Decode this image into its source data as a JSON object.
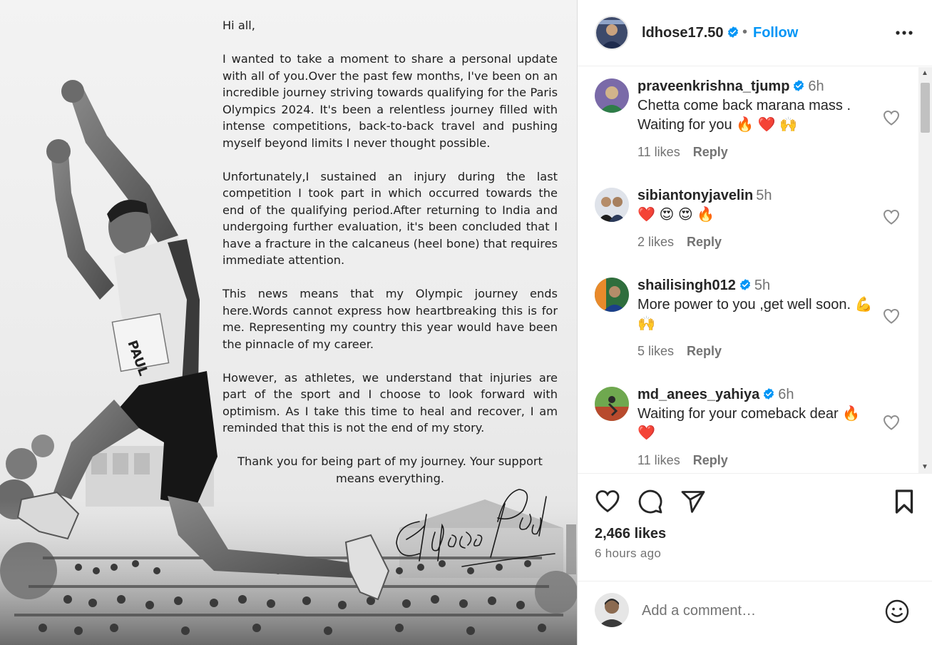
{
  "letter": {
    "greeting": "Hi all,",
    "p1": "I wanted to take a moment to share a  personal update with all of you.Over the past few months, I've been on an incredible journey striving towards qualifying for the Paris Olympics 2024. It's been a relentless journey filled with intense competitions, back-to-back travel and pushing myself beyond limits I never thought possible.",
    "p2": "Unfortunately,I sustained an injury during the last competition I took part in which occurred towards the end of the qualifying period.After returning to India and undergoing further evaluation, it's been concluded that I have a fracture in the calcaneus (heel bone) that requires immediate attention.",
    "p3": "This news means that my Olympic journey ends here.Words cannot express how heartbreaking this is for me. Representing my country this year would have been the pinnacle of my career.",
    "p4": "However, as athletes, we understand that injuries are part of the sport and  I choose to look forward with optimism. As I take this time to heal and recover, I am reminded that this is not the end of my story.",
    "thanks": "Thank you for being part of my journey. Your support means everything.",
    "signature": "Eldhose Paul",
    "bib": "PAUL"
  },
  "header": {
    "username": "ldhose17.50",
    "separator": "•",
    "follow_label": "Follow"
  },
  "comments": [
    {
      "user": "praveenkrishna_tjump",
      "verified": true,
      "time": "6h",
      "text": "Chetta come back marana mass . Waiting for you 🔥 ❤️ 🙌",
      "likes": "11 likes",
      "reply": "Reply"
    },
    {
      "user": "sibiantonyjavelin",
      "verified": false,
      "time": "5h",
      "text": "❤️ 😍 😍 🔥",
      "likes": "2 likes",
      "reply": "Reply"
    },
    {
      "user": "shailisingh012",
      "verified": true,
      "time": "5h",
      "text": "More power to you ,get well soon. 💪 🙌",
      "likes": "5 likes",
      "reply": "Reply"
    },
    {
      "user": "md_anees_yahiya",
      "verified": true,
      "time": "6h",
      "text": "Waiting for your comeback dear 🔥 ❤️",
      "likes": "11 likes",
      "reply": "Reply"
    }
  ],
  "footer": {
    "likes": "2,466 likes",
    "time_ago": "6 hours ago",
    "comment_placeholder": "Add a comment…"
  },
  "colors": {
    "accent": "#0095f6",
    "text": "#262626",
    "muted": "#737373",
    "verified": "#0095f6"
  },
  "icons": [
    "more-icon",
    "heart-icon",
    "comment-icon",
    "share-icon",
    "bookmark-icon",
    "emoji-icon",
    "verified-badge-icon"
  ]
}
